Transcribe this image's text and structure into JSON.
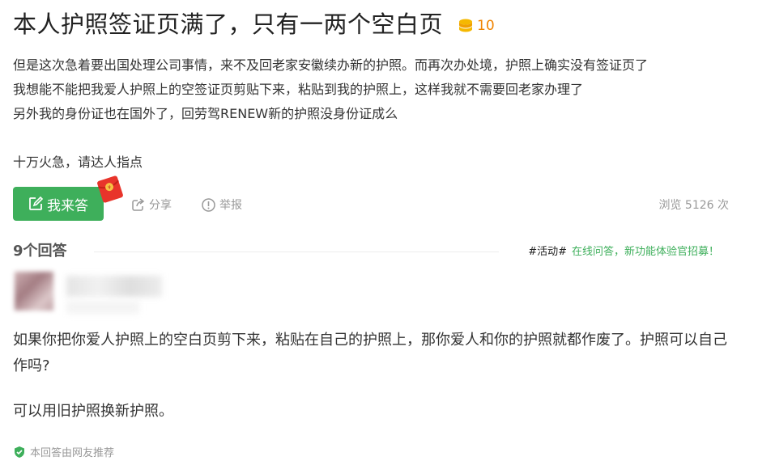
{
  "question": {
    "title": "本人护照签证页满了，只有一两个空白页",
    "reward": "10",
    "lines": [
      "但是这次急着要出国处理公司事情，来不及回老家安徽续办新的护照。而再次办处境，护照上确实没有签证页了",
      "我想能不能把我爱人护照上的空签证页剪贴下来，粘贴到我的护照上，这样我就不需要回老家办理了",
      "另外我的身份证也在国外了，回劳驾RENEW新的护照没身份证成么"
    ],
    "closing": "十万火急，请达人指点"
  },
  "actions": {
    "answer_label": "我来答",
    "share_label": "分享",
    "report_label": "举报",
    "views": "浏览 5126 次"
  },
  "answers_header": {
    "count": "9个回答",
    "promo_tag": "#活动#",
    "promo_text": "在线问答，新功能体验官招募！"
  },
  "answer": {
    "paragraphs": [
      "如果你把你爱人护照上的空白页剪下来，粘贴在自己的护照上，那你爱人和你的护照就都作废了。护照可以自己作吗?",
      "可以用旧护照换新护照。"
    ],
    "recommend": "本回答由网友推荐"
  },
  "colors": {
    "accent": "#3eaf5b",
    "reward": "#f08300",
    "muted": "#999999"
  },
  "icons": [
    "coin-icon",
    "edit-icon",
    "red-envelope-icon",
    "share-icon",
    "report-icon",
    "shield-check-icon"
  ]
}
